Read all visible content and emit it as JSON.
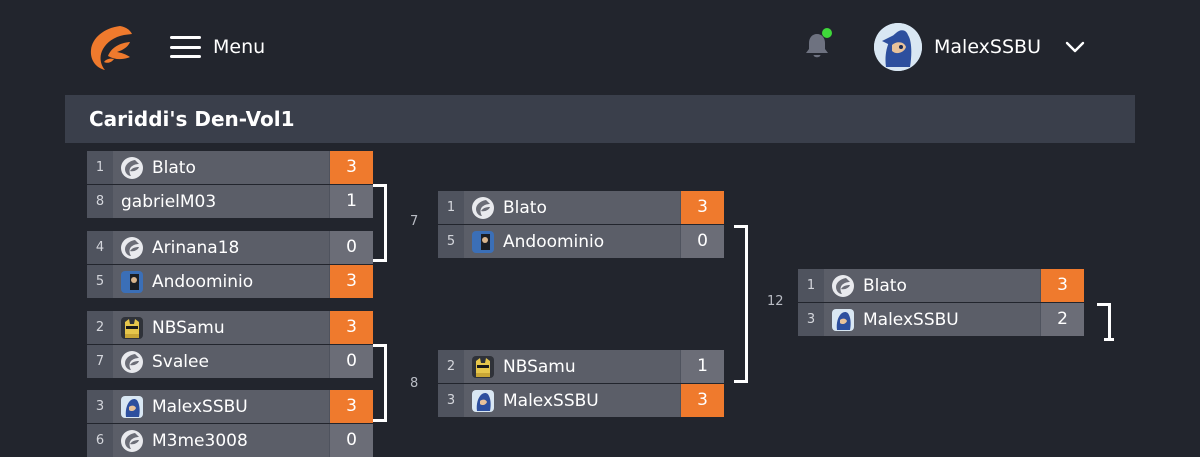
{
  "nav": {
    "menu_label": "Menu",
    "user_name": "MalexSSBU",
    "notification_dot_color": "#3fd83a",
    "brand_color": "#ef7a2d"
  },
  "tournament": {
    "title": "Cariddi's Den-Vol1"
  },
  "bracket": {
    "r1": [
      {
        "label": "",
        "top": {
          "seed": "1",
          "name": "Blato",
          "score": "3"
        },
        "bottom": {
          "seed": "8",
          "name": "gabrielM03",
          "score": "1"
        }
      },
      {
        "label": "",
        "top": {
          "seed": "4",
          "name": "Arinana18",
          "score": "0"
        },
        "bottom": {
          "seed": "5",
          "name": "Andoominio",
          "score": "3"
        }
      },
      {
        "label": "",
        "top": {
          "seed": "2",
          "name": "NBSamu",
          "score": "3"
        },
        "bottom": {
          "seed": "7",
          "name": "Svalee",
          "score": "0"
        }
      },
      {
        "label": "",
        "top": {
          "seed": "3",
          "name": "MalexSSBU",
          "score": "3"
        },
        "bottom": {
          "seed": "6",
          "name": "M3me3008",
          "score": "0"
        }
      }
    ],
    "r2": [
      {
        "label": "7",
        "top": {
          "seed": "1",
          "name": "Blato",
          "score": "3"
        },
        "bottom": {
          "seed": "5",
          "name": "Andoominio",
          "score": "0"
        }
      },
      {
        "label": "8",
        "top": {
          "seed": "2",
          "name": "NBSamu",
          "score": "1"
        },
        "bottom": {
          "seed": "3",
          "name": "MalexSSBU",
          "score": "3"
        }
      }
    ],
    "r3": [
      {
        "label": "12",
        "top": {
          "seed": "1",
          "name": "Blato",
          "score": "3"
        },
        "bottom": {
          "seed": "3",
          "name": "MalexSSBU",
          "score": "2"
        }
      }
    ]
  }
}
